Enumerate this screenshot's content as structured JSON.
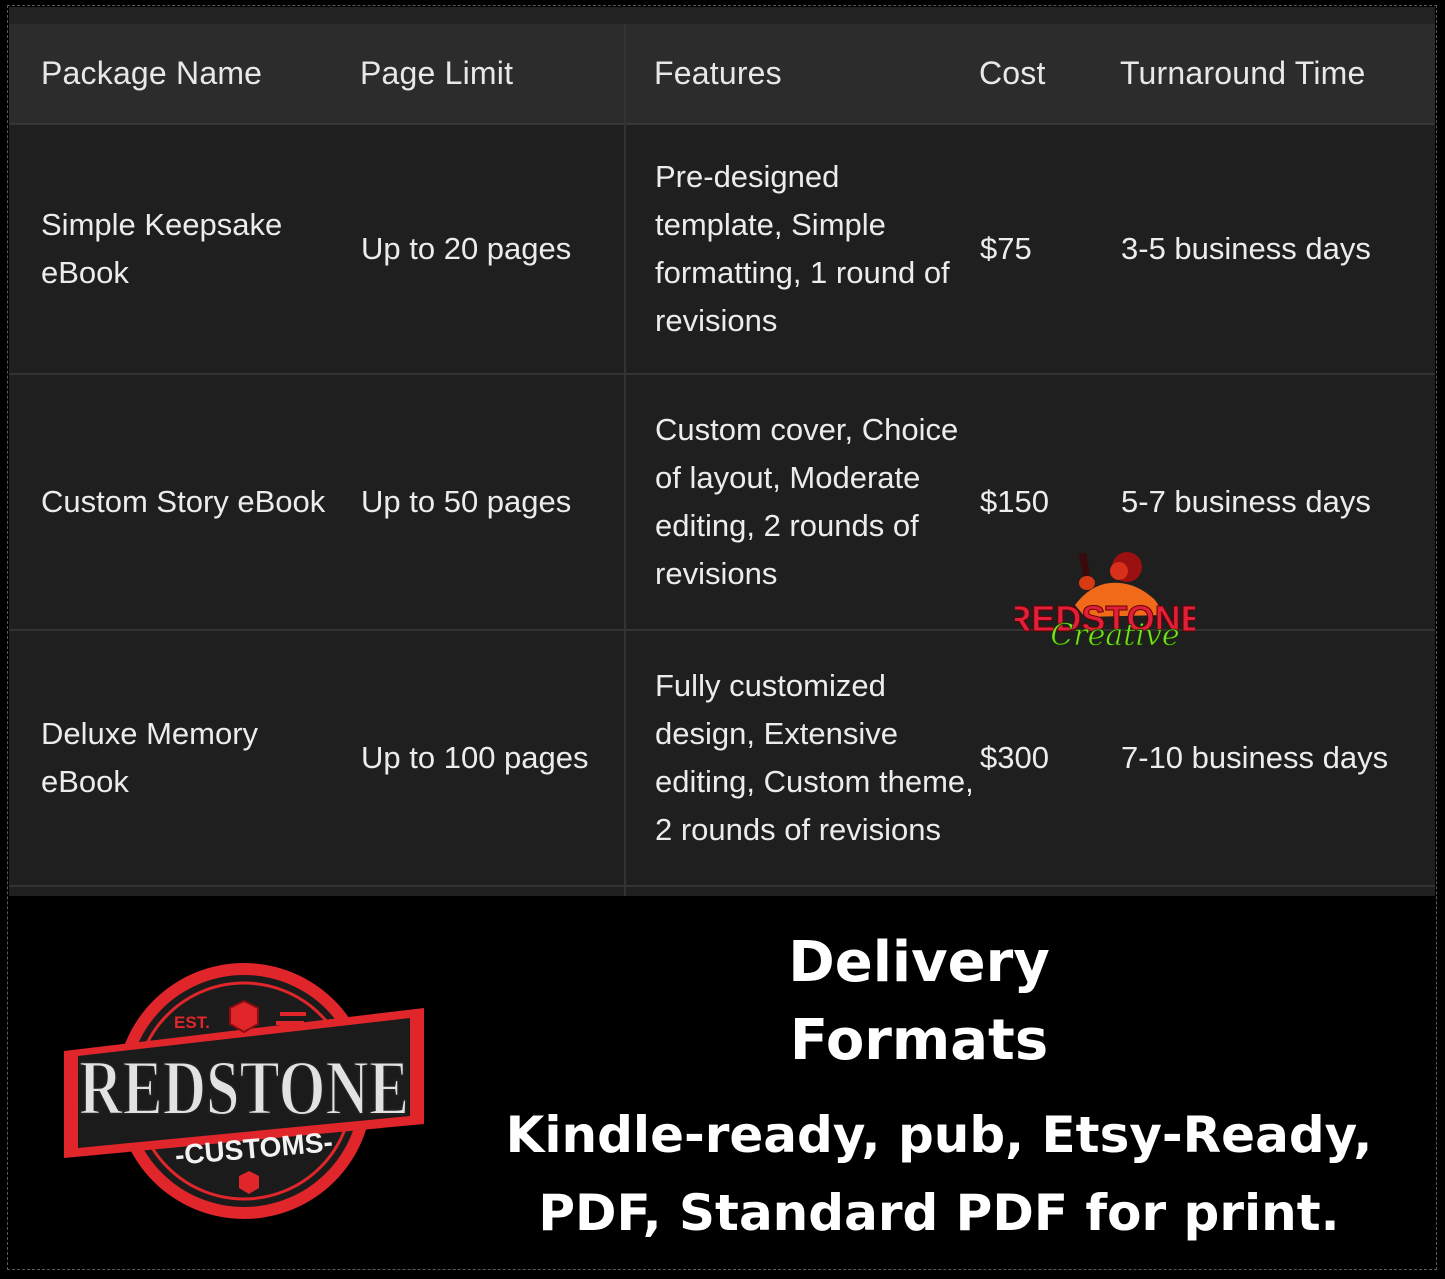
{
  "table": {
    "headers": [
      "Package Name",
      "Page Limit",
      "Features",
      "Cost",
      "Turnaround Time"
    ],
    "rows": [
      {
        "name": "Simple Keepsake eBook",
        "page_limit": "Up to 20 pages",
        "features": "Pre-designed template, Simple formatting, 1 round of revisions",
        "cost": "$75",
        "turnaround": "3-5 business days"
      },
      {
        "name": "Custom Story eBook",
        "page_limit": "Up to 50 pages",
        "features": "Custom cover, Choice of layout, Moderate editing, 2 rounds of revisions",
        "cost": "$150",
        "turnaround": "5-7 business days"
      },
      {
        "name": "Deluxe Memory eBook",
        "page_limit": "Up to 100 pages",
        "features": "Fully customized design, Extensive editing, Custom theme, 2 rounds of revisions",
        "cost": "$300",
        "turnaround": "7-10 business days"
      }
    ]
  },
  "watermark": {
    "brand_top": "REDSTONE",
    "brand_script": "Creative",
    "icon": "woman-with-pistol-illustration"
  },
  "logo": {
    "est_label": "EST.",
    "title": "REDSTONE",
    "subtitle": "-CUSTOMS-",
    "icon": "red-gem-icon",
    "colors": {
      "red": "#e0262b",
      "dark": "#1b1b1b",
      "silver": "#d9d9d9"
    }
  },
  "delivery": {
    "title_line1": "Delivery",
    "title_line2": "Formats",
    "formats_line1": "Kindle-ready, pub, Etsy-Ready,",
    "formats_line2": "PDF, Standard PDF for print."
  }
}
